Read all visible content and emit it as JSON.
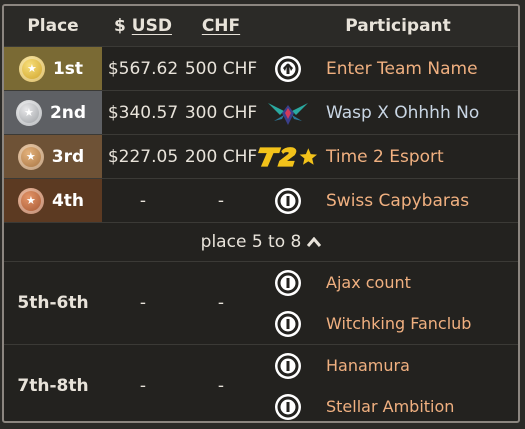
{
  "header": {
    "place": "Place",
    "usd_prefix": "$",
    "usd": "USD",
    "chf": "CHF",
    "participant": "Participant"
  },
  "top_rows": [
    {
      "place": "1st",
      "medal": "gold",
      "usd": "$567.62",
      "chf": "500 CHF",
      "logo": "overwatch-logo",
      "name": "Enter Team Name"
    },
    {
      "place": "2nd",
      "medal": "silver",
      "usd": "$340.57",
      "chf": "300 CHF",
      "logo": "wasp-logo",
      "name": "Wasp X Ohhhh No"
    },
    {
      "place": "3rd",
      "medal": "bronze",
      "usd": "$227.05",
      "chf": "200 CHF",
      "logo": "t2e-logo",
      "name": "Time 2 Esport"
    },
    {
      "place": "4th",
      "medal": "copper",
      "usd": "-",
      "chf": "-",
      "logo": "overwatch-logo",
      "name": "Swiss Capybaras"
    }
  ],
  "toggle": {
    "label": "place 5 to 8",
    "icon": "chevron-up-icon"
  },
  "groups": [
    {
      "place": "5th-6th",
      "usd": "-",
      "chf": "-",
      "teams": [
        {
          "logo": "overwatch-logo",
          "name": "Ajax count"
        },
        {
          "logo": "overwatch-logo",
          "name": "Witchking Fanclub"
        }
      ]
    },
    {
      "place": "7th-8th",
      "usd": "-",
      "chf": "-",
      "teams": [
        {
          "logo": "overwatch-logo",
          "name": "Hanamura"
        },
        {
          "logo": "overwatch-logo",
          "name": "Stellar Ambition"
        }
      ]
    }
  ],
  "colors": {
    "accent_name": "#f0b080",
    "gold": "#7a6a34",
    "silver": "#5e6064",
    "bronze": "#6e5236",
    "copper": "#5c3a22"
  }
}
